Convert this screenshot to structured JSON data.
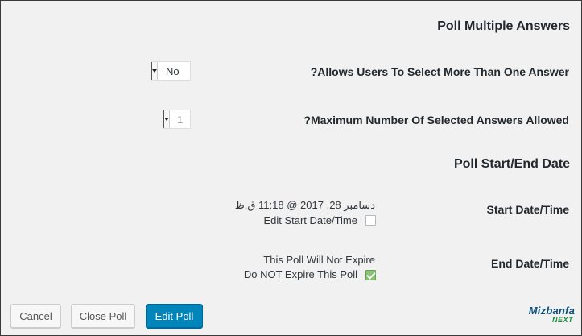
{
  "sections": {
    "multiple_answers_title": "Poll Multiple Answers",
    "start_end_title": "Poll Start/End Date"
  },
  "multiple": {
    "allow_label": "?Allows Users To Select More Than One Answer",
    "allow_value": "No",
    "max_label": "?Maximum Number Of Selected Answers Allowed",
    "max_value": "1"
  },
  "start": {
    "label": "Start Date/Time",
    "value": "دسامبر 28, 2017 @ 11:18 ق.ظ",
    "edit_checkbox_label": "Edit Start Date/Time",
    "edit_checked": false
  },
  "end": {
    "label": "End Date/Time",
    "value": "This Poll Will Not Expire",
    "no_expire_label": "Do NOT Expire This Poll",
    "no_expire_checked": true
  },
  "buttons": {
    "cancel": "Cancel",
    "close_poll": "Close Poll",
    "edit_poll": "Edit Poll"
  },
  "logo": {
    "brand": "Mizbanfa",
    "sub": "NEXT"
  },
  "colors": {
    "primary_button": "#0085ba",
    "checkbox_checked": "#86c470"
  }
}
